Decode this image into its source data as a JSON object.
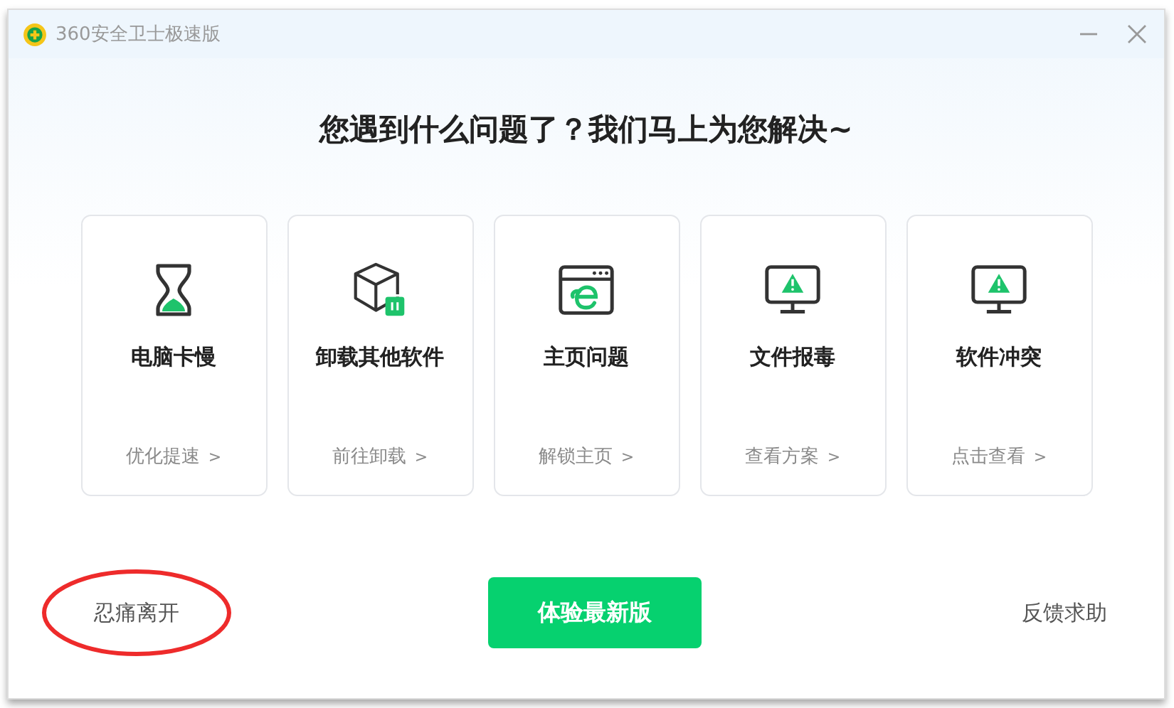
{
  "window": {
    "title": "360安全卫士极速版"
  },
  "heading": "您遇到什么问题了？我们马上为您解决~",
  "cards": [
    {
      "kind": "hourglass",
      "title": "电脑卡慢",
      "action": "优化提速",
      "arrow": ">"
    },
    {
      "kind": "uninstall",
      "title": "卸载其他软件",
      "action": "前往卸载",
      "arrow": ">"
    },
    {
      "kind": "browser",
      "title": "主页问题",
      "action": "解锁主页",
      "arrow": ">"
    },
    {
      "kind": "warning",
      "title": "文件报毒",
      "action": "查看方案",
      "arrow": ">"
    },
    {
      "kind": "warning",
      "title": "软件冲突",
      "action": "点击查看",
      "arrow": ">"
    }
  ],
  "footer": {
    "leave": "忍痛离开",
    "primary": "体验最新版",
    "feedback": "反馈求助"
  }
}
